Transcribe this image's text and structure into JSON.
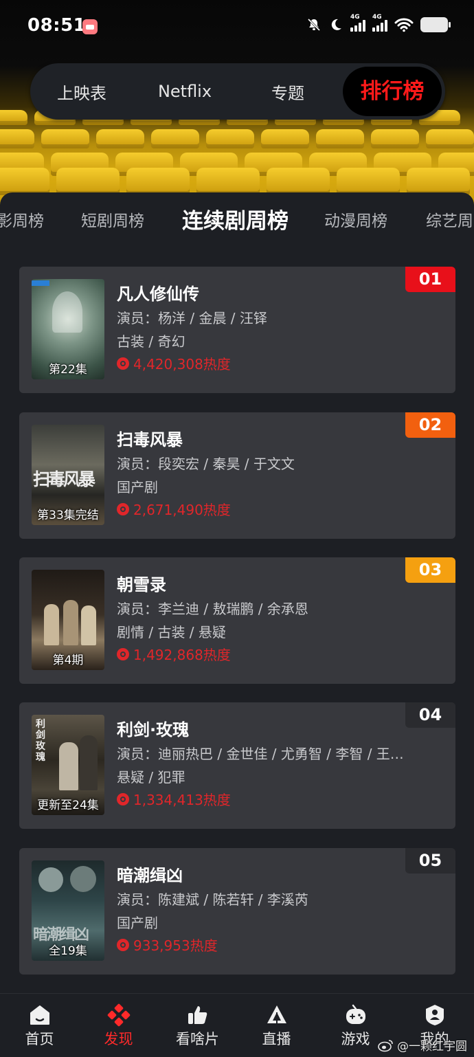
{
  "status_bar": {
    "time": "08:51",
    "network_1": "4G",
    "network_2": "4G"
  },
  "top_tabs": [
    {
      "label": "上映表",
      "active": false
    },
    {
      "label": "Netflix",
      "active": false
    },
    {
      "label": "专题",
      "active": false
    },
    {
      "label": "排行榜",
      "active": true
    }
  ],
  "sub_tabs": [
    {
      "label": "影周榜",
      "active": false
    },
    {
      "label": "短剧周榜",
      "active": false
    },
    {
      "label": "连续剧周榜",
      "active": true
    },
    {
      "label": "动漫周榜",
      "active": false
    },
    {
      "label": "综艺周",
      "active": false
    }
  ],
  "rankings": [
    {
      "rank": "01",
      "rank_color": "#e8101a",
      "title": "凡人修仙传",
      "cast": "演员：杨洋 / 金晨 / 汪铎",
      "genre": "古装 / 奇幻",
      "heat": "4,420,308热度",
      "poster_label": "第22集",
      "poster_text": ""
    },
    {
      "rank": "02",
      "rank_color": "#f2600f",
      "title": "扫毒风暴",
      "cast": "演员：段奕宏 / 秦昊 / 于文文",
      "genre": "国产剧",
      "heat": "2,671,490热度",
      "poster_label": "第33集完结",
      "poster_text": "扫毒风暴"
    },
    {
      "rank": "03",
      "rank_color": "#f5a010",
      "title": "朝雪录",
      "cast": "演员：李兰迪 / 敖瑞鹏 / 余承恩",
      "genre": "剧情 / 古装 / 悬疑",
      "heat": "1,492,868热度",
      "poster_label": "第4期",
      "poster_text": ""
    },
    {
      "rank": "04",
      "rank_color": "#2a2b2f",
      "title": "利剑·玫瑰",
      "cast": "演员：迪丽热巴 / 金世佳 / 尤勇智 / 李智 / 王…",
      "genre": "悬疑 / 犯罪",
      "heat": "1,334,413热度",
      "poster_label": "更新至24集",
      "poster_text": "利剑玫瑰"
    },
    {
      "rank": "05",
      "rank_color": "#2a2b2f",
      "title": "暗潮缉凶",
      "cast": "演员：陈建斌 / 陈若轩 / 李溪芮",
      "genre": "国产剧",
      "heat": "933,953热度",
      "poster_label": "全19集",
      "poster_text": "暗潮缉凶"
    }
  ],
  "bottom_nav": [
    {
      "label": "首页",
      "icon": "home-icon",
      "active": false
    },
    {
      "label": "发现",
      "icon": "discover-icon",
      "active": true
    },
    {
      "label": "看啥片",
      "icon": "thumbs-up-icon",
      "active": false
    },
    {
      "label": "直播",
      "icon": "live-icon",
      "active": false
    },
    {
      "label": "游戏",
      "icon": "gamepad-icon",
      "active": false
    },
    {
      "label": "我的",
      "icon": "profile-icon",
      "active": false
    }
  ],
  "watermark": "@一颗红宇圆",
  "accent_color": "#ff1a1a"
}
